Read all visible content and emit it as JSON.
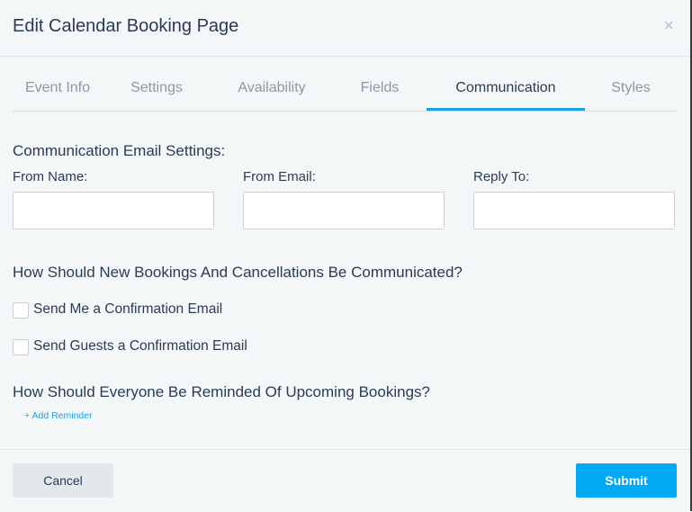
{
  "modal": {
    "title": "Edit Calendar Booking Page",
    "close_icon": "×"
  },
  "tabs": [
    {
      "label": "Event Info",
      "active": false
    },
    {
      "label": "Settings",
      "active": false
    },
    {
      "label": "Availability",
      "active": false
    },
    {
      "label": "Fields",
      "active": false
    },
    {
      "label": "Communication",
      "active": true
    },
    {
      "label": "Styles",
      "active": false
    }
  ],
  "email_settings": {
    "heading": "Communication Email Settings:",
    "from_name_label": "From Name:",
    "from_name_value": "",
    "from_email_label": "From Email:",
    "from_email_value": "",
    "reply_to_label": "Reply To:",
    "reply_to_value": ""
  },
  "notifications": {
    "heading": "How Should New Bookings And Cancellations Be Communicated?",
    "options": [
      {
        "label": "Send Me a Confirmation Email",
        "checked": false
      },
      {
        "label": "Send Guests a Confirmation Email",
        "checked": false
      }
    ]
  },
  "reminders": {
    "heading": "How Should Everyone Be Reminded Of Upcoming Bookings?",
    "add_link": "+ Add Reminder"
  },
  "footer": {
    "cancel_label": "Cancel",
    "submit_label": "Submit"
  },
  "colors": {
    "accent": "#03a9f4",
    "tab_underline": "#1da1e0",
    "text": "#2a3b55",
    "muted_tab": "#8b98a6",
    "background": "#f4f7f8"
  }
}
